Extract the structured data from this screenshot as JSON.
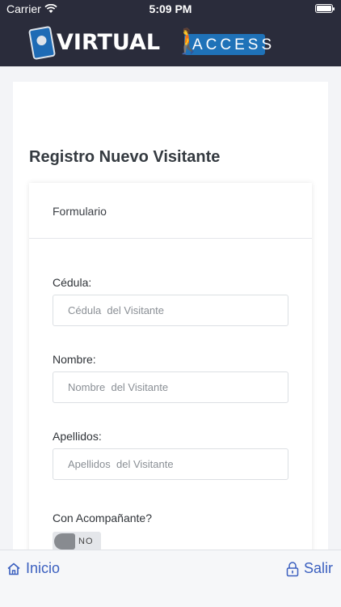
{
  "status_bar": {
    "carrier": "Carrier",
    "time": "5:09 PM"
  },
  "brand": {
    "virtual": "VIRTUAL",
    "access": "ACCESS",
    "colors": {
      "header_bg": "#2a2c3b",
      "accent": "#1f72b8"
    }
  },
  "page": {
    "title": "Registro Nuevo Visitante",
    "form_header": "Formulario"
  },
  "form": {
    "cedula": {
      "label": "Cédula:",
      "placeholder": "Cédula  del Visitante"
    },
    "nombre": {
      "label": "Nombre:",
      "placeholder": "Nombre  del Visitante"
    },
    "apellidos": {
      "label": "Apellidos:",
      "placeholder": "Apellidos  del Visitante"
    },
    "acompanante": {
      "label": "Con Acompañante?",
      "toggle_text": "NO"
    }
  },
  "bottom_nav": {
    "home": {
      "label": "Inicio",
      "icon": "home-icon"
    },
    "exit": {
      "label": "Salir",
      "icon": "lock-icon"
    }
  }
}
